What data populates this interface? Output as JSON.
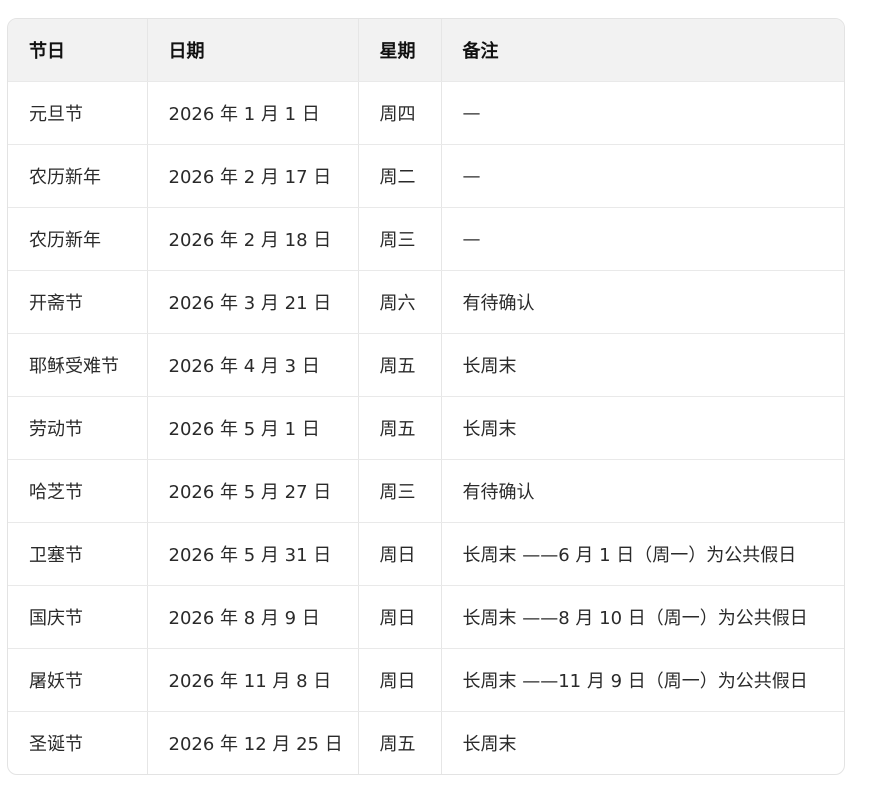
{
  "table": {
    "headers": {
      "holiday": "节日",
      "date": "日期",
      "weekday": "星期",
      "note": "备注"
    },
    "rows": [
      {
        "holiday": "元旦节",
        "date": "2026 年 1 月 1 日",
        "weekday": "周四",
        "note": "—"
      },
      {
        "holiday": "农历新年",
        "date": "2026 年 2 月 17 日",
        "weekday": "周二",
        "note": "—"
      },
      {
        "holiday": "农历新年",
        "date": "2026 年 2 月 18 日",
        "weekday": "周三",
        "note": "—"
      },
      {
        "holiday": "开斋节",
        "date": "2026 年 3 月 21 日",
        "weekday": "周六",
        "note": "有待确认"
      },
      {
        "holiday": "耶稣受难节",
        "date": "2026 年 4 月 3 日",
        "weekday": "周五",
        "note": "长周末"
      },
      {
        "holiday": "劳动节",
        "date": "2026 年 5 月 1 日",
        "weekday": "周五",
        "note": "长周末"
      },
      {
        "holiday": "哈芝节",
        "date": "2026 年 5 月 27 日",
        "weekday": "周三",
        "note": "有待确认"
      },
      {
        "holiday": "卫塞节",
        "date": "2026 年 5 月 31 日",
        "weekday": "周日",
        "note": "长周末 ——6 月 1 日（周一）为公共假日"
      },
      {
        "holiday": "国庆节",
        "date": "2026 年 8 月 9 日",
        "weekday": "周日",
        "note": "长周末 ——8 月 10 日（周一）为公共假日"
      },
      {
        "holiday": "屠妖节",
        "date": "2026 年 11 月 8 日",
        "weekday": "周日",
        "note": "长周末 ——11 月 9 日（周一）为公共假日"
      },
      {
        "holiday": "圣诞节",
        "date": "2026 年 12 月 25 日",
        "weekday": "周五",
        "note": "长周末"
      }
    ]
  }
}
